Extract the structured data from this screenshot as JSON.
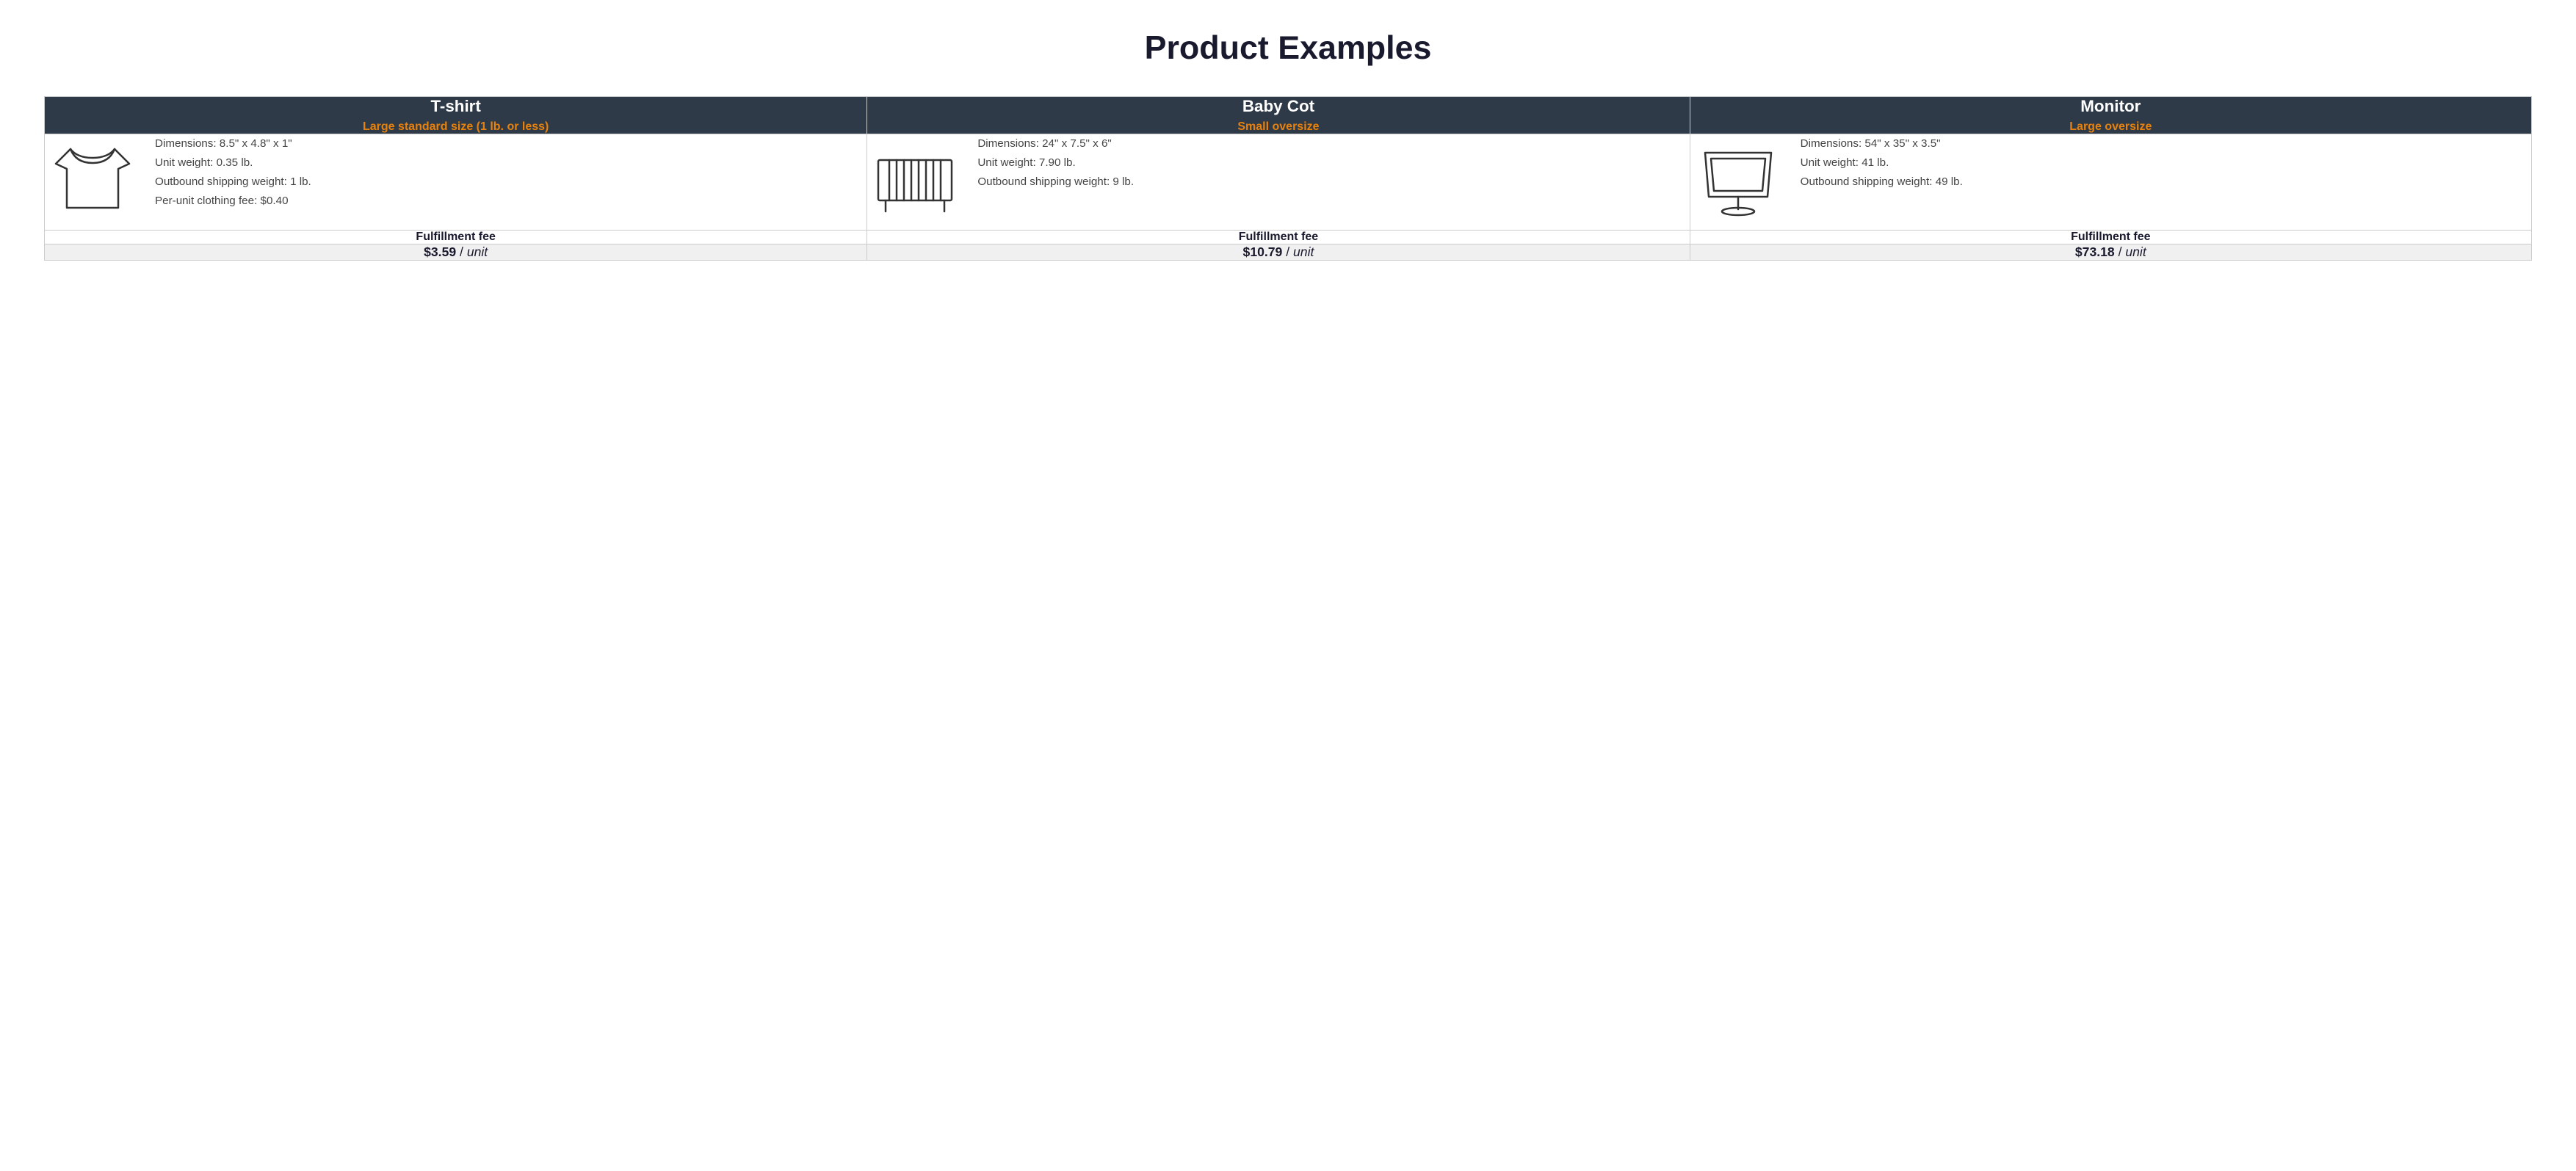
{
  "page": {
    "title": "Product Examples"
  },
  "columns": [
    {
      "id": "tshirt",
      "name": "T-shirt",
      "size_category": "Large standard size (1 lb. or less)",
      "specs": [
        "Dimensions: 8.5\" x 4.8\" x 1\"",
        "Unit weight: 0.35 lb.",
        "Outbound shipping weight: 1 lb.",
        "Per-unit clothing fee: $0.40"
      ],
      "fulfillment_fee_amount": "$3.59",
      "fulfillment_fee_unit": "unit",
      "fulfillment_label": "Fulfillment fee",
      "icon": "tshirt"
    },
    {
      "id": "babycot",
      "name": "Baby Cot",
      "size_category": "Small oversize",
      "specs": [
        "Dimensions: 24\" x 7.5\" x 6\"",
        "Unit weight: 7.90 lb.",
        "Outbound shipping weight: 9 lb."
      ],
      "fulfillment_fee_amount": "$10.79",
      "fulfillment_fee_unit": "unit",
      "fulfillment_label": "Fulfillment fee",
      "icon": "babycot"
    },
    {
      "id": "monitor",
      "name": "Monitor",
      "size_category": "Large oversize",
      "specs": [
        "Dimensions: 54\" x 35\" x 3.5\"",
        "Unit weight: 41 lb.",
        "Outbound shipping weight: 49 lb."
      ],
      "fulfillment_fee_amount": "$73.18",
      "fulfillment_fee_unit": "unit",
      "fulfillment_label": "Fulfillment fee",
      "icon": "monitor"
    }
  ]
}
